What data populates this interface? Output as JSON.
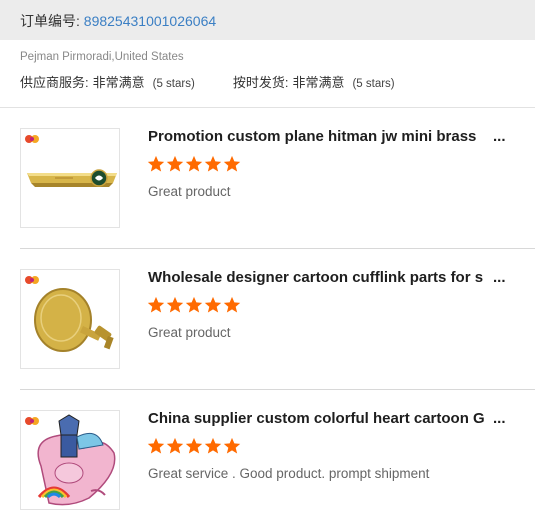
{
  "order": {
    "label": "订单编号:",
    "number": "89825431001026064"
  },
  "buyer": "Pejman Pirmoradi,United States",
  "ratings": [
    {
      "label": "供应商服务:",
      "value": "非常满意",
      "stars_text": "(5 stars)"
    },
    {
      "label": "按时发货:",
      "value": "非常满意",
      "stars_text": "(5 stars)"
    }
  ],
  "items": [
    {
      "title": "Promotion custom plane hitman jw mini brass",
      "rating": 5,
      "review": "Great product",
      "image": "gold-tie-clip"
    },
    {
      "title": "Wholesale designer cartoon cufflink parts for s",
      "rating": 5,
      "review": "Great product",
      "image": "gold-cufflink"
    },
    {
      "title": "China supplier custom colorful heart cartoon G",
      "rating": 5,
      "review": "Great service . Good product. prompt shipment",
      "image": "cartoon-pin"
    }
  ],
  "ellipsis": "...",
  "colors": {
    "link": "#3b7fc4",
    "star": "#ff6a00",
    "order_bar": "#ececec"
  }
}
